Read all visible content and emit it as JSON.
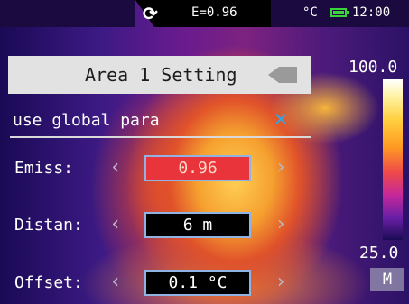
{
  "status_bar": {
    "refresh_icon": "refresh-icon",
    "emissivity": "E=0.96",
    "unit": "°C",
    "battery_icon": "battery-icon",
    "time": "12:00"
  },
  "header": {
    "title": "Area 1 Setting",
    "back_icon": "back-arrow-icon"
  },
  "global_param": {
    "label": "use global para",
    "clear_icon": "close-icon"
  },
  "settings": {
    "emiss": {
      "label": "Emiss:",
      "value": "0.96"
    },
    "distan": {
      "label": "Distan:",
      "value": "6 m"
    },
    "offset": {
      "label": "Offset:",
      "value": "0.1 °C"
    }
  },
  "chevrons": {
    "left": "‹",
    "right": "›"
  },
  "scale": {
    "max": "100.0",
    "min": "25.0",
    "mode": "M"
  },
  "colors": {
    "accent_blue": "#2fa6ea",
    "selected_field": "#e8343a",
    "battery": "#3bd23b"
  }
}
